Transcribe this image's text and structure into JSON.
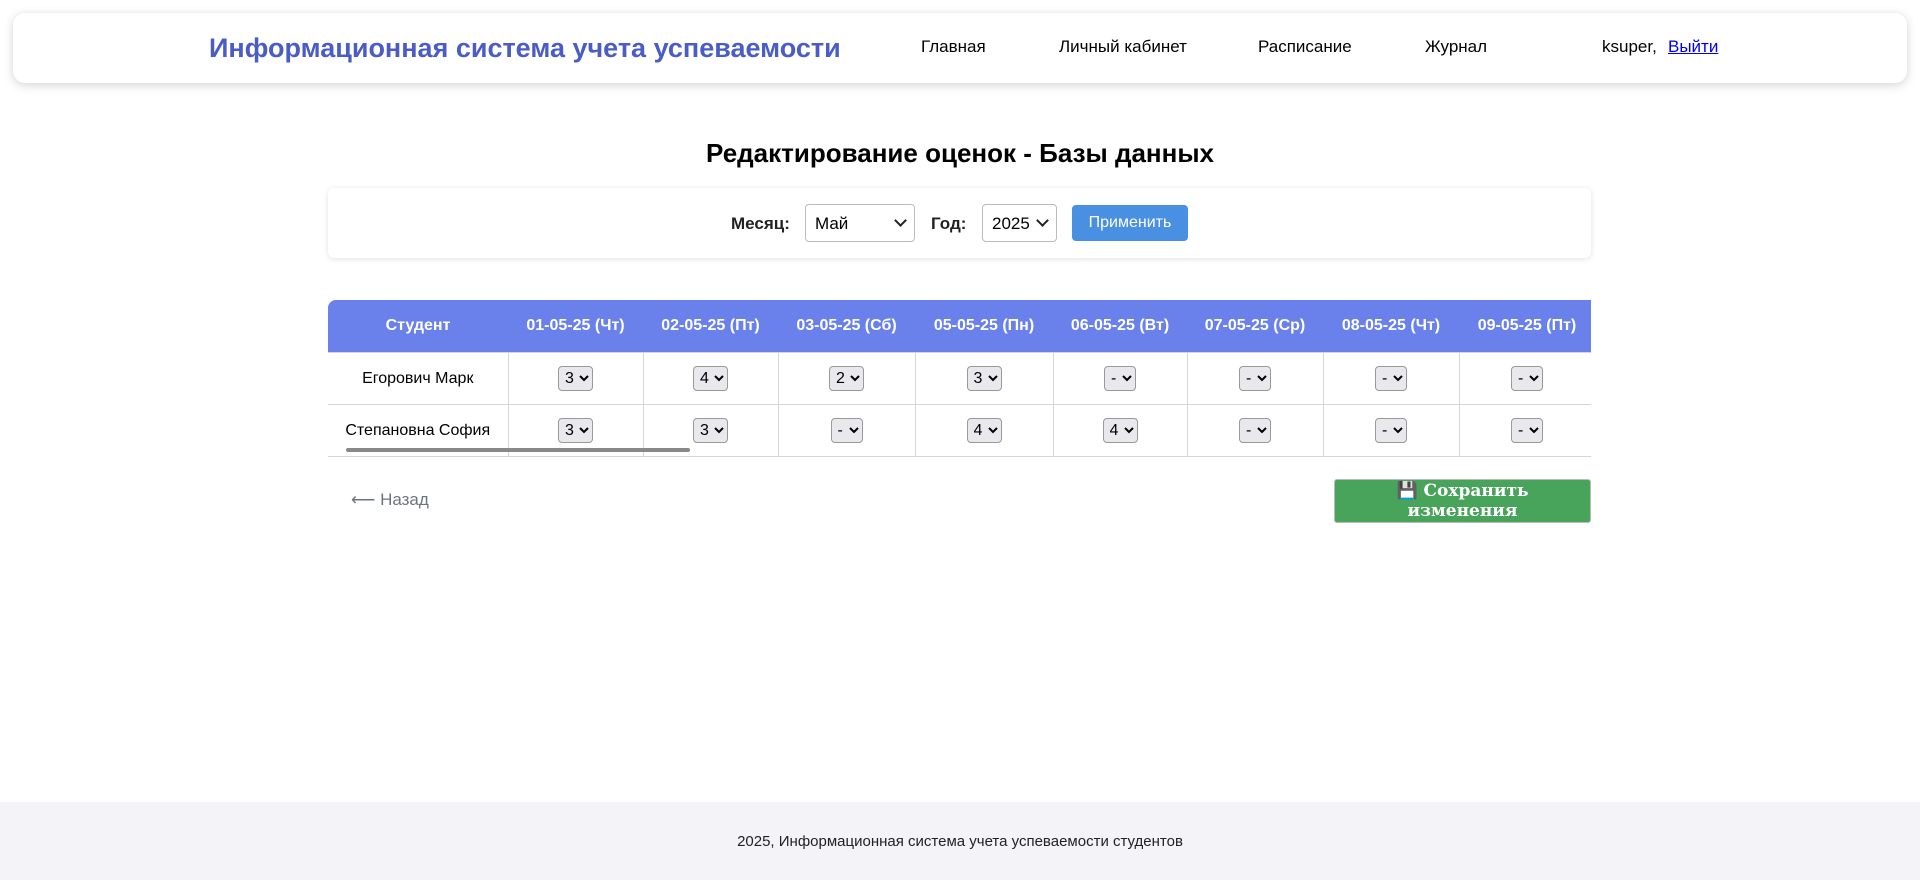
{
  "header": {
    "brand": "Информационная система учета успеваемости",
    "nav": [
      "Главная",
      "Личный кабинет",
      "Расписание",
      "Журнал"
    ],
    "user": "ksuper,",
    "logout": "Выйти"
  },
  "page_title": "Редактирование оценок - Базы данных",
  "filter": {
    "month_label": "Месяц:",
    "month_value": "Май",
    "year_label": "Год:",
    "year_value": "2025",
    "apply_label": "Применить"
  },
  "table": {
    "headers": [
      "Студент",
      "01-05-25 (Чт)",
      "02-05-25 (Пт)",
      "03-05-25 (Сб)",
      "05-05-25 (Пн)",
      "06-05-25 (Вт)",
      "07-05-25 (Ср)",
      "08-05-25 (Чт)",
      "09-05-25 (Пт)"
    ],
    "rows": [
      {
        "student": "Егорович Марк",
        "grades": [
          "3",
          "4",
          "2",
          "3",
          "-",
          "-",
          "-",
          "-"
        ]
      },
      {
        "student": "Степановна София",
        "grades": [
          "3",
          "3",
          "-",
          "4",
          "4",
          "-",
          "-",
          "-"
        ]
      }
    ]
  },
  "back_label": "⟵ Назад",
  "save_label": "💾 Сохранить изменения",
  "footer": "2025, Информационная система учета успеваемости студентов",
  "colors": {
    "brand": "#4a5cc5",
    "table_header": "#6a80ea",
    "apply": "#4a90e2",
    "save": "#48a45a"
  }
}
